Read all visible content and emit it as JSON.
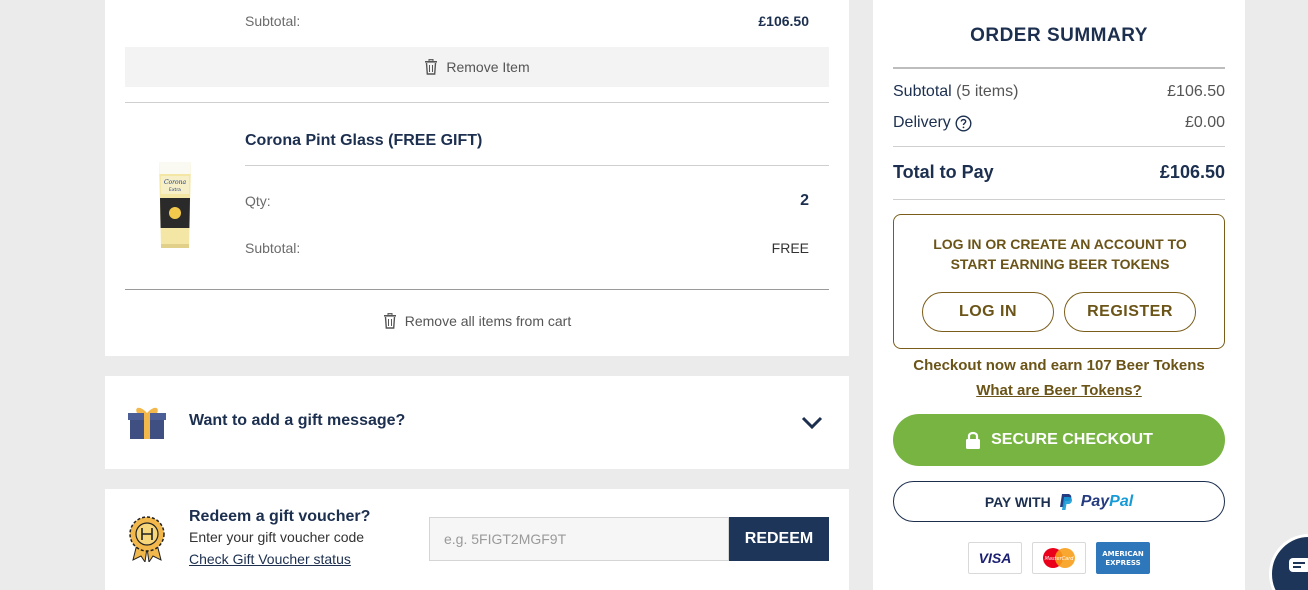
{
  "cart": {
    "prev_item": {
      "subtotal_label": "Subtotal:",
      "subtotal_value": "£106.50",
      "remove_label": "Remove Item"
    },
    "item": {
      "name": "Corona Pint Glass (FREE GIFT)",
      "qty_label": "Qty:",
      "qty_value": "2",
      "subtotal_label": "Subtotal:",
      "subtotal_value": "FREE",
      "image_text": "Corona Extra"
    },
    "remove_all_label": "Remove all items from cart"
  },
  "gift_message": {
    "label": "Want to add a gift message?"
  },
  "voucher": {
    "title": "Redeem a gift voucher?",
    "subtitle": "Enter your gift voucher code",
    "status_link": "Check Gift Voucher status",
    "placeholder": "e.g. 5FIGT2MGF9T",
    "button_label": "REDEEM"
  },
  "summary": {
    "title": "ORDER SUMMARY",
    "subtotal_label": "Subtotal",
    "subtotal_count": "(5 items)",
    "subtotal_value": "£106.50",
    "delivery_label": "Delivery",
    "delivery_value": "£0.00",
    "total_label": "Total to Pay",
    "total_value": "£106.50",
    "tokens_message_line1": "LOG IN OR CREATE AN ACCOUNT TO",
    "tokens_message_line2": "START EARNING BEER TOKENS",
    "login_label": "LOG IN",
    "register_label": "REGISTER",
    "earn_text": "Checkout now and earn 107 Beer Tokens",
    "what_link": "What are Beer Tokens?",
    "checkout_label": "SECURE CHECKOUT",
    "paypal_prefix": "PAY WITH",
    "paypal_pay": "Pay",
    "paypal_pal": "Pal",
    "payment_logos": {
      "visa": "VISA",
      "mastercard": "MasterCard",
      "amex_line1": "AMERICAN",
      "amex_line2": "EXPRESS"
    }
  },
  "colors": {
    "navy": "#1c2f4f",
    "gold": "#6b5418",
    "green": "#78b442",
    "background": "#ebebeb"
  }
}
